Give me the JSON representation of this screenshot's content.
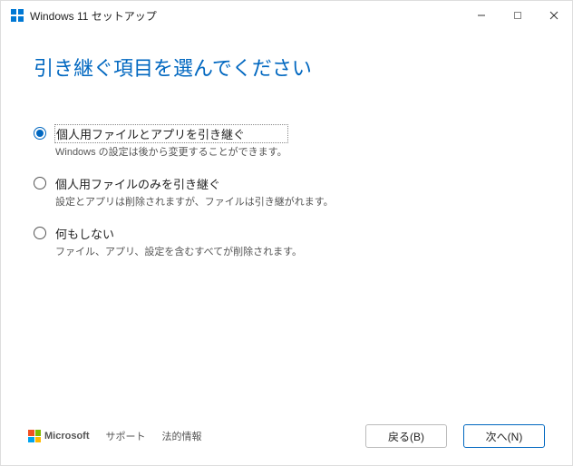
{
  "window": {
    "title": "Windows 11 セットアップ"
  },
  "page": {
    "title": "引き継ぐ項目を選んでください"
  },
  "options": [
    {
      "label": "個人用ファイルとアプリを引き継ぐ",
      "description": "Windows の設定は後から変更することができます。",
      "selected": true
    },
    {
      "label": "個人用ファイルのみを引き継ぐ",
      "description": "設定とアプリは削除されますが、ファイルは引き継がれます。",
      "selected": false
    },
    {
      "label": "何もしない",
      "description": "ファイル、アプリ、設定を含むすべてが削除されます。",
      "selected": false
    }
  ],
  "footer": {
    "brand": "Microsoft",
    "links": [
      "サポート",
      "法的情報"
    ],
    "back": "戻る(B)",
    "next": "次へ(N)"
  }
}
